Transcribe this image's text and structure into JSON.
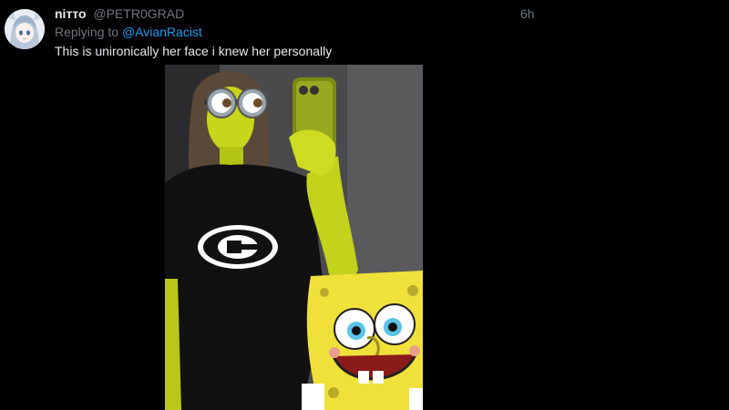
{
  "tweet": {
    "display_name": "nітто",
    "handle": "@PETR0GRAD",
    "timestamp": "6h",
    "reply_prefix": "Replying to",
    "reply_to": "@AvianRacist",
    "text": "This is unironically her face i knew her personally"
  },
  "icons": {
    "avatar": "anime-character-avatar-icon",
    "media": "meme-photo-minion-face-spongebob"
  },
  "colors": {
    "background": "#000000",
    "primary_text": "#e7e9ea",
    "secondary_text": "#6e767d",
    "link": "#1d9bf0"
  }
}
